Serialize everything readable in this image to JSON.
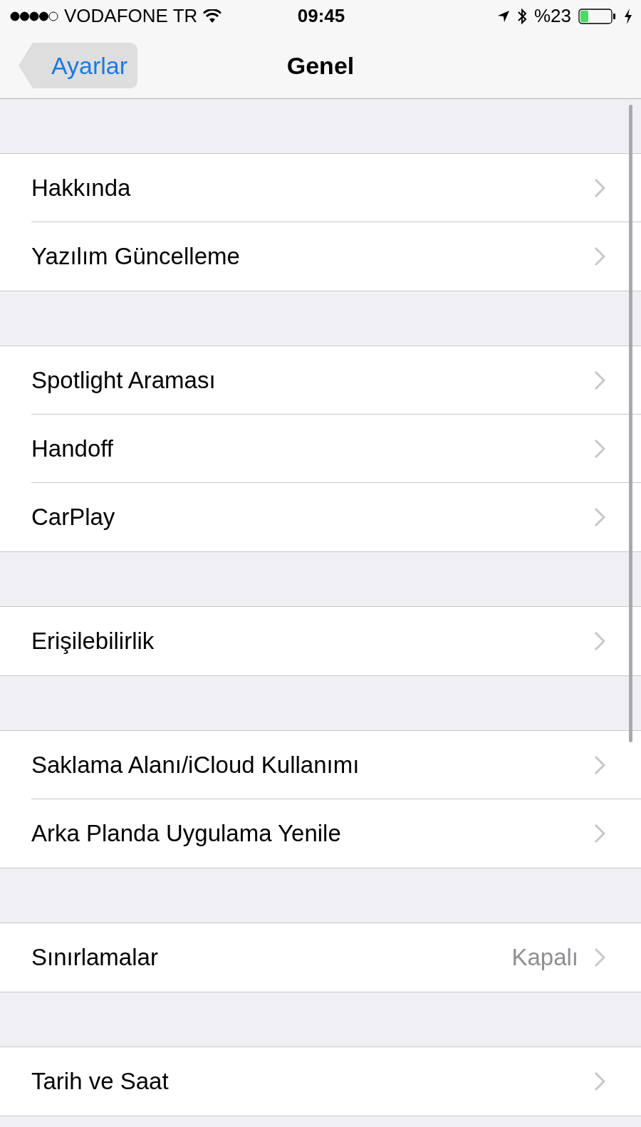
{
  "status_bar": {
    "carrier": "VODAFONE TR",
    "time": "09:45",
    "battery": "%23"
  },
  "nav": {
    "back": {
      "label": "Ayarlar",
      "highlighted": true
    },
    "title": "Genel"
  },
  "groups": [
    {
      "items": [
        {
          "label": "Hakkında"
        },
        {
          "label": "Yazılım Güncelleme"
        }
      ]
    },
    {
      "items": [
        {
          "label": "Spotlight Araması"
        },
        {
          "label": "Handoff"
        },
        {
          "label": "CarPlay"
        }
      ]
    },
    {
      "items": [
        {
          "label": "Erişilebilirlik"
        }
      ]
    },
    {
      "items": [
        {
          "label": "Saklama Alanı/iCloud Kullanımı"
        },
        {
          "label": "Arka Planda Uygulama Yenile"
        }
      ]
    },
    {
      "items": [
        {
          "label": "Sınırlamalar",
          "value": "Kapalı"
        }
      ]
    },
    {
      "items": [
        {
          "label": "Tarih ve Saat"
        }
      ]
    }
  ]
}
